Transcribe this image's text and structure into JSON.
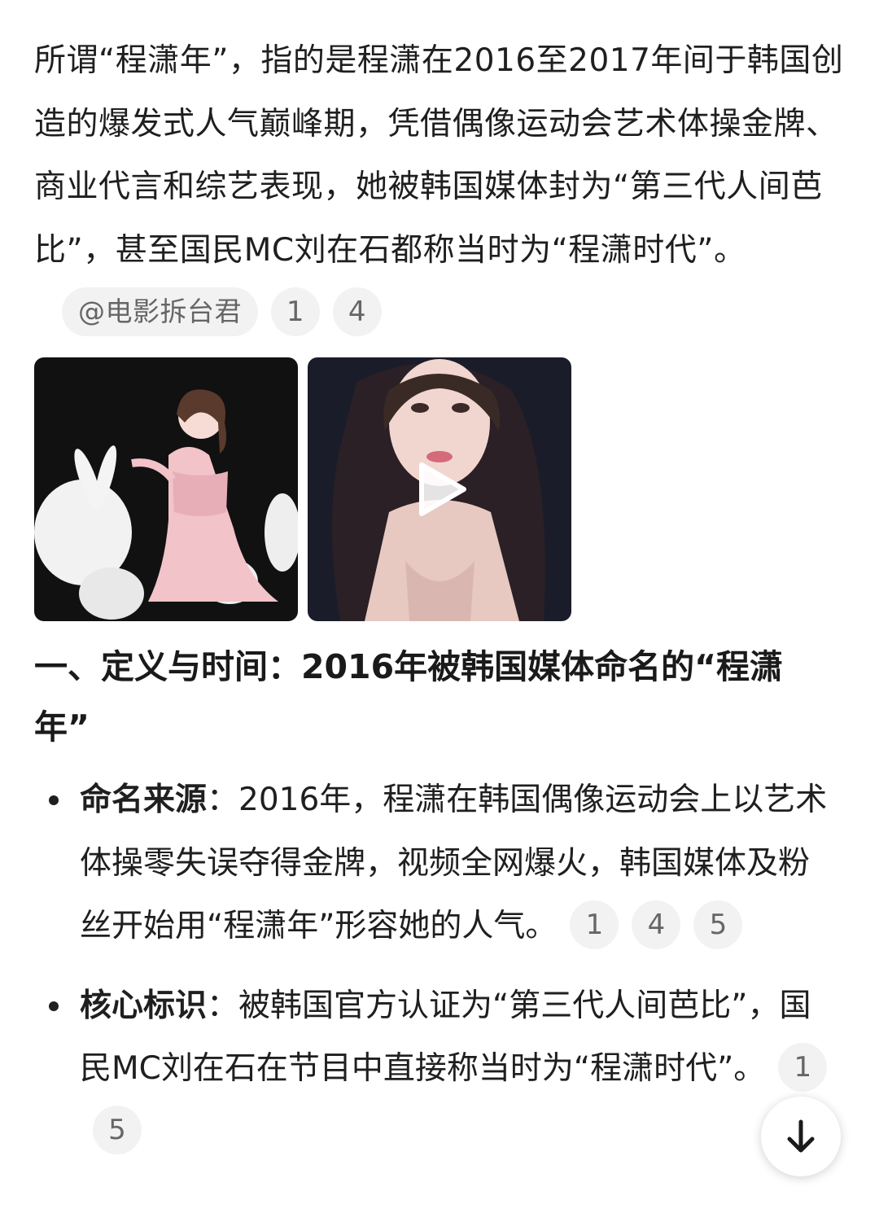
{
  "intro": {
    "text": "所谓“程潇年”，指的是程潇在2016至2017年间于韩国创造的爆发式人气巅峰期，凭借偶像运动会艺术体操金牌、商业代言和综艺表现，她被韩国媒体封为“第三代人间芭比”，甚至国民MC刘在石都称当时为“程潇时代”。",
    "source_chip": "@电影拆台君",
    "citations": [
      "1",
      "4"
    ]
  },
  "images": [
    {
      "icon": "photo-pink-gown-rabbits"
    },
    {
      "icon": "video-thumbnail",
      "play_icon": "play-icon"
    }
  ],
  "section": {
    "title": "一、定义与时间：2016年被韩国媒体命名的“程潇年”"
  },
  "bullets": [
    {
      "lead": "命名来源",
      "sep": "：",
      "text": "2016年，程潇在韩国偶像运动会上以艺术体操零失误夺得金牌，视频全网爆火，韩国媒体及粉丝开始用“程潇年”形容她的人气。",
      "citations": [
        "1",
        "4",
        "5"
      ]
    },
    {
      "lead": "核心标识",
      "sep": "：",
      "text": "被韩国官方认证为“第三代人间芭比”，国民MC刘在石在节目中直接称当时为“程潇时代”。",
      "citations": [
        "1",
        "5"
      ]
    }
  ],
  "scroll_button": {
    "icon": "arrow-down-icon"
  }
}
